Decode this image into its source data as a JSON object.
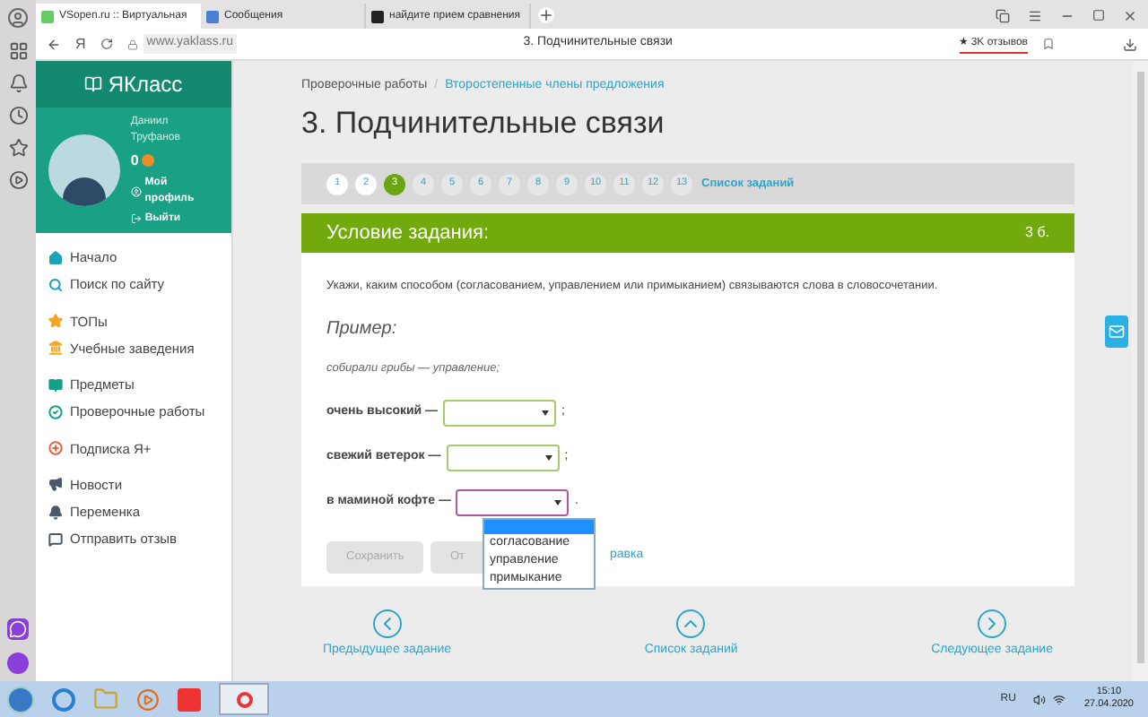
{
  "browser": {
    "tabs": [
      {
        "label": "VSopen.ru :: Виртуальная",
        "selected": true
      },
      {
        "label": "Сообщения",
        "selected": false
      },
      {
        "label": "найдите прием сравнения",
        "selected": false
      }
    ],
    "home_button": "Я",
    "url": "www.yaklass.ru",
    "page_title": "3. Подчинительные связи",
    "reviews": "★ 3K отзывов"
  },
  "sidebar": {
    "logo": "ЯКласс",
    "user": {
      "first_name": "Даниил",
      "last_name": "Труфанов",
      "points": "0",
      "links": [
        {
          "kind": "profile",
          "label": "Мой профиль"
        },
        {
          "kind": "logout",
          "label": "Выйти"
        }
      ]
    },
    "groups": [
      [
        {
          "kind": "home",
          "label": "Начало",
          "color": "#1aa3b8"
        },
        {
          "kind": "search",
          "label": "Поиск по сайту",
          "color": "#1aa3b8"
        }
      ],
      [
        {
          "kind": "star",
          "label": "ТОПы",
          "color": "#f5a623"
        },
        {
          "kind": "school",
          "label": "Учебные заведения",
          "color": "#f5a623"
        }
      ],
      [
        {
          "kind": "books",
          "label": "Предметы",
          "color": "#16a085"
        },
        {
          "kind": "check",
          "label": "Проверочные работы",
          "color": "#16a085"
        }
      ],
      [
        {
          "kind": "plus",
          "label": "Подписка Я+",
          "color": "#e8603c"
        }
      ],
      [
        {
          "kind": "megaphone",
          "label": "Новости",
          "color": "#4a5a66"
        },
        {
          "kind": "bell",
          "label": "Переменка",
          "color": "#4a5a66"
        },
        {
          "kind": "chat",
          "label": "Отправить отзыв",
          "color": "#4a5a66"
        }
      ]
    ]
  },
  "breadcrumbs": [
    {
      "label": "Проверочные работы",
      "link": false
    },
    {
      "separator": "/",
      "label": "Второстепенные члены предложения",
      "link": true
    }
  ],
  "title": "3. Подчинительные связи",
  "pager": {
    "pages": [
      {
        "label": "1",
        "selected": false,
        "visited": true
      },
      {
        "label": "2",
        "selected": false,
        "visited": true
      },
      {
        "label": "3",
        "selected": true
      },
      {
        "label": "4",
        "selected": false,
        "visited": false
      },
      {
        "label": "5",
        "selected": false,
        "visited": false
      },
      {
        "label": "6",
        "selected": false,
        "visited": false
      },
      {
        "label": "7",
        "selected": false,
        "visited": false
      },
      {
        "label": "8",
        "selected": false,
        "visited": false
      },
      {
        "label": "9",
        "selected": false,
        "visited": false
      },
      {
        "label": "10",
        "selected": false,
        "visited": false
      },
      {
        "label": "11",
        "selected": false,
        "visited": false
      },
      {
        "label": "12",
        "selected": false,
        "visited": false
      },
      {
        "label": "13",
        "selected": false,
        "visited": false
      }
    ],
    "list_link": "Список заданий"
  },
  "task": {
    "header": "Условие задания:",
    "score": "3 б.",
    "instruction": "Укажи, каким способом (согласованием, управлением или примыканием) связываются слова в словосочетании.",
    "example_heading": "Пример:",
    "example": "собирали грибы — управление;",
    "items": [
      {
        "phrase": "очень высокий —",
        "open": false,
        "end": ";"
      },
      {
        "phrase": "свежий ветерок —",
        "open": false,
        "end": ";"
      },
      {
        "phrase": "в маминой кофте —",
        "open": true,
        "end": ".",
        "options": [
          "согласование",
          "управление",
          "примыкание"
        ]
      }
    ],
    "buttons": [
      {
        "label": "Сохранить",
        "disabled": true
      },
      {
        "label": "От",
        "disabled": true
      }
    ],
    "help_link": "равка"
  },
  "nav": [
    {
      "kind": "prev",
      "label": "Предыдущее задание"
    },
    {
      "kind": "up",
      "label": "Список заданий"
    },
    {
      "kind": "next",
      "label": "Следующее задание"
    }
  ],
  "taskbar": {
    "language": "RU",
    "time": "15:10",
    "date": "27.04.2020"
  }
}
